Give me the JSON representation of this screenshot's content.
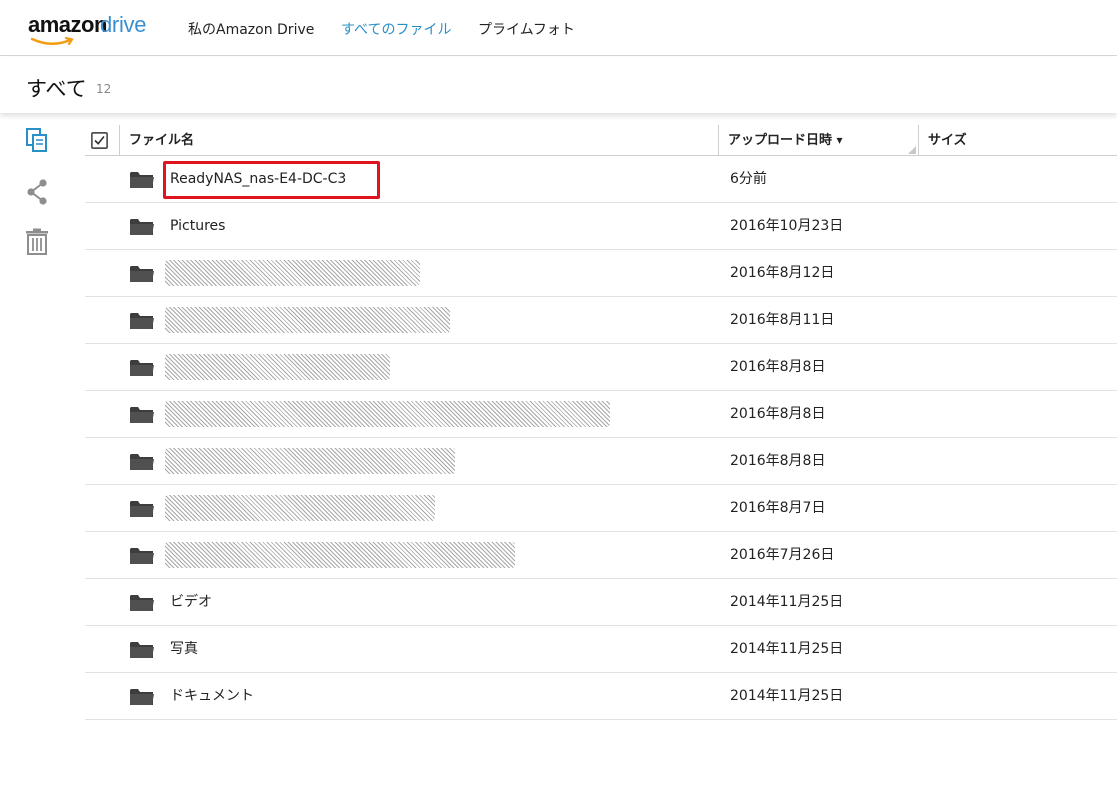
{
  "app": {
    "logo_text_primary": "amazon",
    "logo_text_secondary": "drive",
    "brand_color": "#3a8fd1",
    "logo_smile_color": "#f39c12"
  },
  "nav": {
    "items": [
      {
        "label": "私のAmazon Drive",
        "active": false
      },
      {
        "label": "すべてのファイル",
        "active": true
      },
      {
        "label": "プライムフォト",
        "active": false
      }
    ],
    "active_color": "#2a8fc7"
  },
  "header": {
    "title": "すべて",
    "count": "12"
  },
  "toolbar": {
    "icons": [
      "copy-icon",
      "share-icon",
      "trash-icon"
    ]
  },
  "table": {
    "columns": {
      "select_all_icon": "checkbox-icon",
      "name": "ファイル名",
      "uploaded": "アップロード日時",
      "sort_icon": "▾",
      "size": "サイズ"
    },
    "rows": [
      {
        "name": "ReadyNAS_nas-E4-DC-C3",
        "date": "6分前",
        "highlighted": true,
        "obscured": false
      },
      {
        "name": "Pictures",
        "date": "2016年10月23日",
        "highlighted": false,
        "obscured": false
      },
      {
        "name": "",
        "date": "2016年8月12日",
        "highlighted": false,
        "obscured": true
      },
      {
        "name": "",
        "date": "2016年8月11日",
        "highlighted": false,
        "obscured": true
      },
      {
        "name": "",
        "date": "2016年8月8日",
        "highlighted": false,
        "obscured": true
      },
      {
        "name": "",
        "date": "2016年8月8日",
        "highlighted": false,
        "obscured": true
      },
      {
        "name": "",
        "date": "2016年8月8日",
        "highlighted": false,
        "obscured": true
      },
      {
        "name": "",
        "date": "2016年8月7日",
        "highlighted": false,
        "obscured": true
      },
      {
        "name": "",
        "date": "2016年7月26日",
        "highlighted": false,
        "obscured": true
      },
      {
        "name": "ビデオ",
        "date": "2014年11月25日",
        "highlighted": false,
        "obscured": false
      },
      {
        "name": "写真",
        "date": "2014年11月25日",
        "highlighted": false,
        "obscured": false
      },
      {
        "name": "ドキュメント",
        "date": "2014年11月25日",
        "highlighted": false,
        "obscured": false
      }
    ],
    "row_icon": "folder-icon",
    "highlight_color": "#e0141e"
  }
}
